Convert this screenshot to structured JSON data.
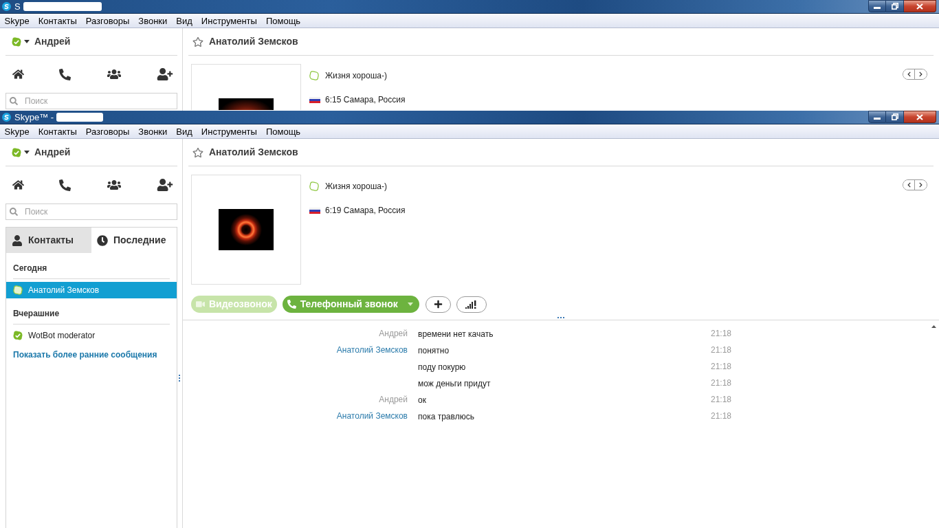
{
  "background_window": {
    "title": "S",
    "menu": [
      "Skype",
      "Контакты",
      "Разговоры",
      "Звонки",
      "Вид",
      "Инструменты",
      "Помощь"
    ],
    "user": {
      "name": "Андрей",
      "online": true
    },
    "search": {
      "placeholder": "Поиск"
    },
    "contact": {
      "name": "Анатолий Земсков",
      "favorite": false,
      "online": false,
      "mood": "Жизня хороша-)",
      "local_time": "6:15 Самара, Россия"
    }
  },
  "active_window": {
    "title": "Skype™ -",
    "menu": [
      "Skype",
      "Контакты",
      "Разговоры",
      "Звонки",
      "Вид",
      "Инструменты",
      "Помощь"
    ],
    "user": {
      "name": "Андрей",
      "online": true
    },
    "search": {
      "placeholder": "Поиск"
    },
    "tabs": [
      {
        "label": "Контакты",
        "selected": false
      },
      {
        "label": "Последние",
        "selected": true
      }
    ],
    "recent": {
      "groups": [
        {
          "heading": "Сегодня",
          "items": [
            {
              "name": "Анатолий Земсков",
              "online": false,
              "selected": true
            }
          ]
        },
        {
          "heading": "Вчерашние",
          "items": [
            {
              "name": "WotBot moderator",
              "online": true,
              "selected": false
            }
          ]
        }
      ],
      "more_link": "Показать более ранние сообщения"
    },
    "contact": {
      "name": "Анатолий Земсков",
      "favorite": false,
      "online": false,
      "mood": "Жизня хороша-)",
      "local_time": "6:19 Самара, Россия"
    },
    "calls": [
      {
        "label": "Видеозвонок",
        "disabled": true,
        "dropdown": false
      },
      {
        "label": "Телефонный звонок",
        "disabled": false,
        "dropdown": true
      }
    ],
    "messages": [
      {
        "sender": "Андрей",
        "self": true,
        "text": "времени нет качать",
        "time": "21:18"
      },
      {
        "sender": "Анатолий Земсков",
        "self": false,
        "text": "понятно",
        "time": "21:18"
      },
      {
        "text": "поду покурю",
        "time": "21:18"
      },
      {
        "text": "мож деньги придут",
        "time": "21:18"
      },
      {
        "sender": "Андрей",
        "self": true,
        "text": "ок",
        "time": "21:18"
      },
      {
        "sender": "Анатолий Земсков",
        "self": false,
        "text": "пока травлюсь",
        "time": "21:18"
      }
    ]
  }
}
